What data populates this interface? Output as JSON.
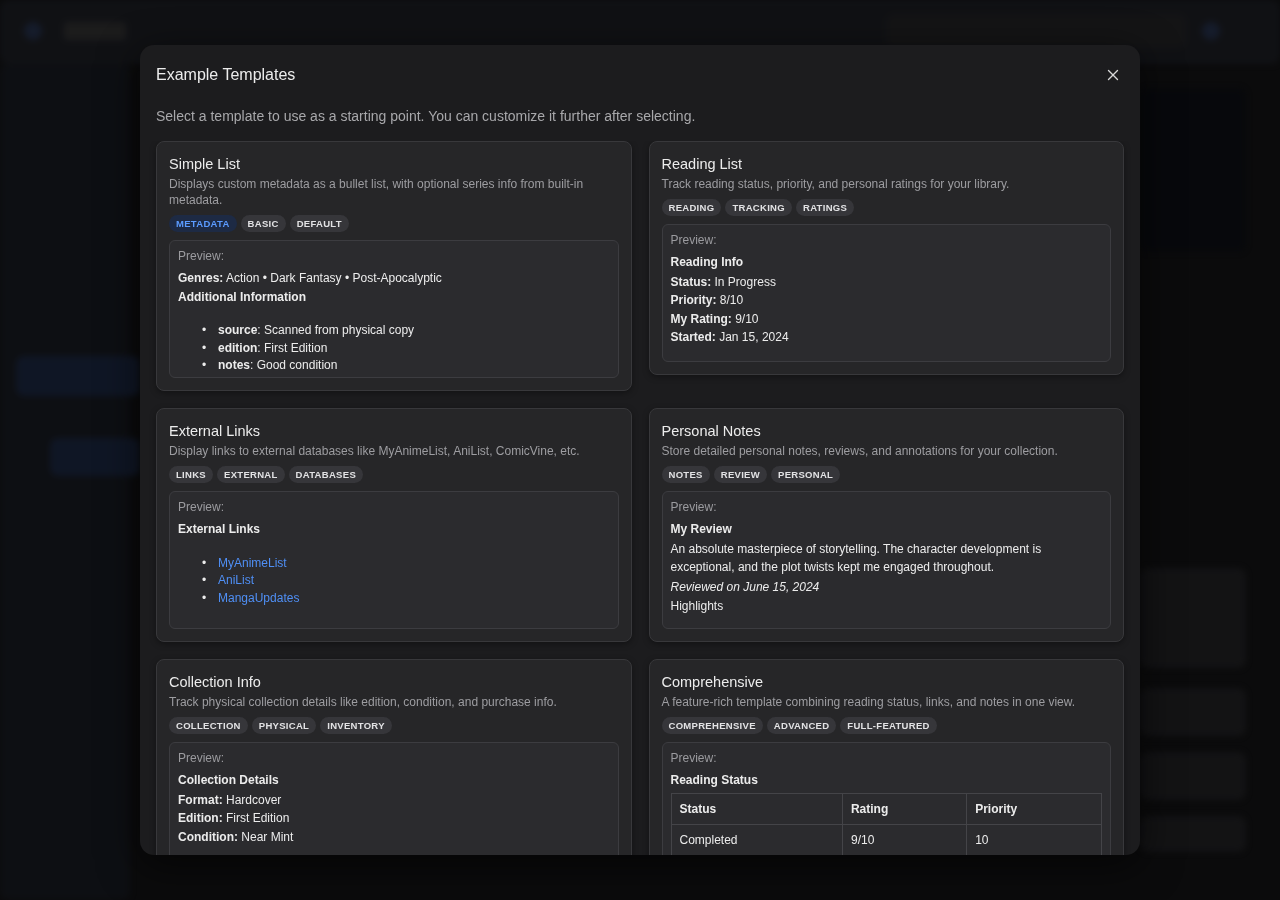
{
  "dialog": {
    "title": "Example Templates",
    "subtitle": "Select a template to use as a starting point. You can customize it further after selecting."
  },
  "templates": [
    {
      "name": "Simple List",
      "description": "Displays custom metadata as a bullet list, with optional series info from built-in metadata.",
      "tags": [
        {
          "label": "METADATA",
          "accent": true
        },
        {
          "label": "BASIC",
          "accent": false
        },
        {
          "label": "DEFAULT",
          "accent": false
        }
      ],
      "preview_label": "Preview:",
      "preview": [
        {
          "kind": "field",
          "label": "Genres:",
          "value": "Action • Dark Fantasy • Post-Apocalyptic"
        },
        {
          "kind": "heading",
          "text": "Additional Information"
        },
        {
          "kind": "list",
          "items": [
            {
              "bullet": "•",
              "key": "source",
              "value": ": Scanned from physical copy"
            },
            {
              "bullet": "•",
              "key": "edition",
              "value": ": First Edition"
            },
            {
              "bullet": "•",
              "key": "notes",
              "value": ": Good condition"
            }
          ]
        }
      ]
    },
    {
      "name": "Reading List",
      "description": "Track reading status, priority, and personal ratings for your library.",
      "tags": [
        {
          "label": "READING",
          "accent": false
        },
        {
          "label": "TRACKING",
          "accent": false
        },
        {
          "label": "RATINGS",
          "accent": false
        }
      ],
      "preview_label": "Preview:",
      "preview": [
        {
          "kind": "heading",
          "text": "Reading Info"
        },
        {
          "kind": "field",
          "label": "Status:",
          "value": "In Progress"
        },
        {
          "kind": "field",
          "label": "Priority:",
          "value": "8/10"
        },
        {
          "kind": "field",
          "label": "My Rating:",
          "value": "9/10"
        },
        {
          "kind": "field",
          "label": "Started:",
          "value": "Jan 15, 2024"
        }
      ]
    },
    {
      "name": "External Links",
      "description": "Display links to external databases like MyAnimeList, AniList, ComicVine, etc.",
      "tags": [
        {
          "label": "LINKS",
          "accent": false
        },
        {
          "label": "EXTERNAL",
          "accent": false
        },
        {
          "label": "DATABASES",
          "accent": false
        }
      ],
      "preview_label": "Preview:",
      "preview": [
        {
          "kind": "heading",
          "text": "External Links"
        },
        {
          "kind": "links",
          "items": [
            {
              "bullet": "•",
              "text": "MyAnimeList"
            },
            {
              "bullet": "•",
              "text": "AniList"
            },
            {
              "bullet": "•",
              "text": "MangaUpdates"
            }
          ]
        }
      ]
    },
    {
      "name": "Personal Notes",
      "description": "Store detailed personal notes, reviews, and annotations for your collection.",
      "tags": [
        {
          "label": "NOTES",
          "accent": false
        },
        {
          "label": "REVIEW",
          "accent": false
        },
        {
          "label": "PERSONAL",
          "accent": false
        }
      ],
      "preview_label": "Preview:",
      "preview": [
        {
          "kind": "heading",
          "text": "My Review"
        },
        {
          "kind": "paragraph",
          "text": "An absolute masterpiece of storytelling. The character development is exceptional, and the plot twists kept me engaged throughout."
        },
        {
          "kind": "italic",
          "text": "Reviewed on June 15, 2024"
        },
        {
          "kind": "paragraph",
          "text": "Highlights"
        }
      ]
    },
    {
      "name": "Collection Info",
      "description": "Track physical collection details like edition, condition, and purchase info.",
      "tags": [
        {
          "label": "COLLECTION",
          "accent": false
        },
        {
          "label": "PHYSICAL",
          "accent": false
        },
        {
          "label": "INVENTORY",
          "accent": false
        }
      ],
      "preview_label": "Preview:",
      "preview": [
        {
          "kind": "heading",
          "text": "Collection Details"
        },
        {
          "kind": "field",
          "label": "Format:",
          "value": "Hardcover"
        },
        {
          "kind": "field",
          "label": "Edition:",
          "value": "First Edition"
        },
        {
          "kind": "field",
          "label": "Condition:",
          "value": "Near Mint"
        }
      ]
    },
    {
      "name": "Comprehensive",
      "description": "A feature-rich template combining reading status, links, and notes in one view.",
      "tags": [
        {
          "label": "COMPREHENSIVE",
          "accent": false
        },
        {
          "label": "ADVANCED",
          "accent": false
        },
        {
          "label": "FULL-FEATURED",
          "accent": false
        }
      ],
      "preview_label": "Preview:",
      "preview": [
        {
          "kind": "heading",
          "text": "Reading Status"
        },
        {
          "kind": "table",
          "columns": [
            "Status",
            "Rating",
            "Priority"
          ],
          "rows": [
            [
              "Completed",
              "9/10",
              "10"
            ]
          ]
        }
      ]
    }
  ]
}
